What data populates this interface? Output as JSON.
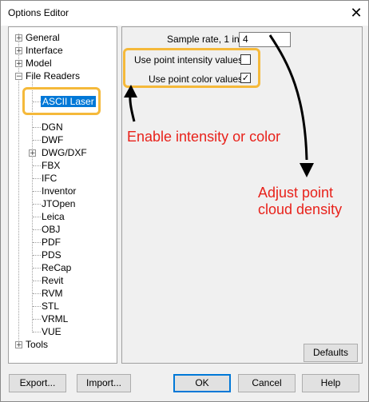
{
  "window": {
    "title": "Options Editor",
    "close_glyph": "✕"
  },
  "tree": {
    "general": "General",
    "interface": "Interface",
    "model": "Model",
    "file_readers": "File Readers",
    "children": {
      "ascii_laser": "ASCII Laser",
      "dgn": "DGN",
      "dwf": "DWF",
      "dwg_dxf": "DWG/DXF",
      "fbx": "FBX",
      "ifc": "IFC",
      "inventor": "Inventor",
      "jtopen": "JTOpen",
      "leica": "Leica",
      "obj": "OBJ",
      "pdf": "PDF",
      "pds": "PDS",
      "recap": "ReCap",
      "revit": "Revit",
      "rvm": "RVM",
      "stl": "STL",
      "vrml": "VRML",
      "vue": "VUE"
    },
    "tools": "Tools",
    "expand_glyph": "+",
    "collapse_glyph": "−"
  },
  "settings": {
    "sample_rate_label": "Sample rate, 1 in",
    "sample_rate_value": "4",
    "intensity_label": "Use point intensity values",
    "intensity_checked": false,
    "color_label": "Use point color values",
    "color_checked": true,
    "check_glyph": "✓"
  },
  "annotations": {
    "enable": "Enable intensity or color",
    "adjust_line1": "Adjust point",
    "adjust_line2": "cloud density",
    "highlight_color": "#f5b93a",
    "text_color": "#e8221b"
  },
  "buttons": {
    "defaults": "Defaults",
    "export": "Export...",
    "import": "Import...",
    "ok": "OK",
    "cancel": "Cancel",
    "help": "Help"
  }
}
